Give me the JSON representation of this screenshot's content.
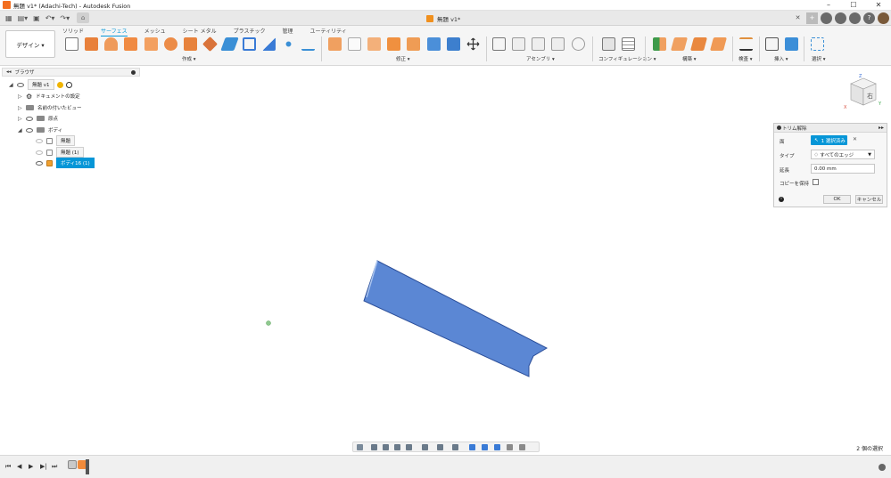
{
  "window": {
    "title": "無題 v1* (Adachi-Tech) - Autodesk Fusion",
    "controls": [
      "–",
      "☐",
      "✕"
    ]
  },
  "document_tab": {
    "label": "無題 v1*"
  },
  "ribbon": {
    "workspace_button": "デザイン ▾",
    "tabs": [
      "ソリッド",
      "サーフェス",
      "メッシュ",
      "シート メタル",
      "プラスチック",
      "管理",
      "ユーティリティ"
    ],
    "active_tab": "サーフェス",
    "groups": [
      "作成 ▾",
      "修正 ▾",
      "アセンブリ ▾",
      "コンフィギュレーション ▾",
      "構築 ▾",
      "検査 ▾",
      "挿入 ▾",
      "選択 ▾"
    ]
  },
  "browser": {
    "header": "ブラウザ",
    "items": [
      {
        "label": "無題 v1"
      },
      {
        "label": "ドキュメントの設定"
      },
      {
        "label": "名前の付いたビュー"
      },
      {
        "label": "原点"
      },
      {
        "label": "ボディ"
      },
      {
        "label": "無題"
      },
      {
        "label": "無題 (1)"
      },
      {
        "label": "ボディ16 (1)"
      }
    ]
  },
  "viewcube": {
    "face_label": "右",
    "axis_x": "X",
    "axis_y": "Y",
    "axis_z": "Z"
  },
  "dialog": {
    "title": "トリム解除",
    "face_label": "面",
    "face_value": "1 選択済み",
    "type_label": "タイプ",
    "type_value": "すべてのエッジ",
    "extend_label": "延長",
    "extend_value": "0.00 mm",
    "keep_copy_label": "コピーを保持",
    "ok": "OK",
    "cancel": "キャンセル"
  },
  "status": {
    "selection": "2 個の選択"
  },
  "colors": {
    "accent": "#0696d7",
    "surface_fill": "#5b87d4",
    "surface_edge": "#2b4e99",
    "origin_point": "#8fc98f"
  }
}
